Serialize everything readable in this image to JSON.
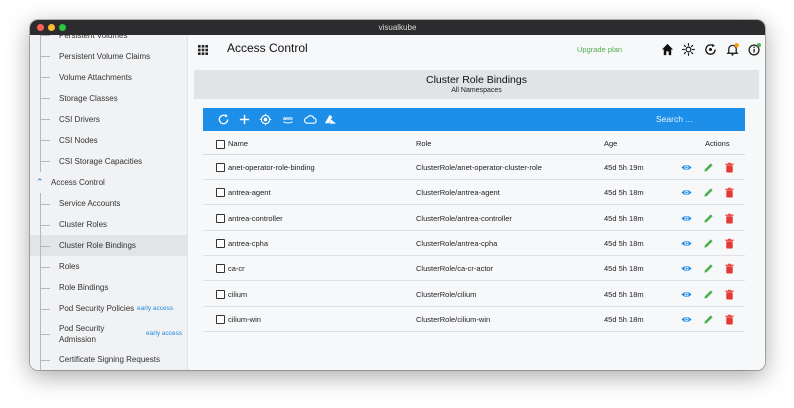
{
  "window": {
    "title": "visualkube"
  },
  "sidebar": {
    "items_before": [
      {
        "label": "Persistent Volumes"
      },
      {
        "label": "Persistent Volume Claims"
      },
      {
        "label": "Volume Attachments"
      },
      {
        "label": "Storage Classes"
      },
      {
        "label": "CSI Drivers"
      },
      {
        "label": "CSI Nodes"
      },
      {
        "label": "CSI Storage Capacities"
      }
    ],
    "group": {
      "label": "Access Control",
      "icon": "chevron-up-icon"
    },
    "items_after": [
      {
        "label": "Service Accounts"
      },
      {
        "label": "Cluster Roles"
      },
      {
        "label": "Cluster Role Bindings",
        "active": true
      },
      {
        "label": "Roles"
      },
      {
        "label": "Role Bindings"
      },
      {
        "label": "Pod Security Policies",
        "badge": "early access"
      },
      {
        "label": "Pod Security\nAdmission",
        "badge": "early access"
      },
      {
        "label": "Certificate Signing Requests"
      }
    ]
  },
  "topbar": {
    "title": "Access Control",
    "upgrade_label": "Upgrade plan",
    "icons": [
      "home-icon",
      "sun-icon",
      "sync-icon",
      "bell-icon",
      "info-icon",
      "panel-icon"
    ]
  },
  "header": {
    "title": "Cluster Role Bindings",
    "subtitle": "All Namespaces"
  },
  "toolbar": {
    "icons": [
      "refresh-icon",
      "plus-icon",
      "helm-icon",
      "aws-icon",
      "cloud-icon",
      "azure-icon"
    ],
    "search_placeholder": "Search ..."
  },
  "table": {
    "columns": {
      "name": "Name",
      "role": "Role",
      "age": "Age",
      "actions": "Actions"
    },
    "rows": [
      {
        "name": "anet-operator-role-binding",
        "role": "ClusterRole/anet-operator-cluster-role",
        "age": "45d 5h 19m"
      },
      {
        "name": "antrea-agent",
        "role": "ClusterRole/antrea-agent",
        "age": "45d 5h 18m"
      },
      {
        "name": "antrea-controller",
        "role": "ClusterRole/antrea-controller",
        "age": "45d 5h 18m"
      },
      {
        "name": "antrea-cpha",
        "role": "ClusterRole/antrea-cpha",
        "age": "45d 5h 18m"
      },
      {
        "name": "ca-cr",
        "role": "ClusterRole/ca-cr-actor",
        "age": "45d 5h 18m"
      },
      {
        "name": "cilium",
        "role": "ClusterRole/cilium",
        "age": "45d 5h 18m"
      },
      {
        "name": "cilium-win",
        "role": "ClusterRole/cilium-win",
        "age": "45d 5h 18m"
      }
    ]
  },
  "colors": {
    "accent": "#1e8fe8",
    "view": "#1e88e5",
    "edit": "#4caf50",
    "delete": "#e53935",
    "upgrade": "#4caf50",
    "notification_dot": "#ff9800",
    "status_dot": "#4caf50"
  }
}
